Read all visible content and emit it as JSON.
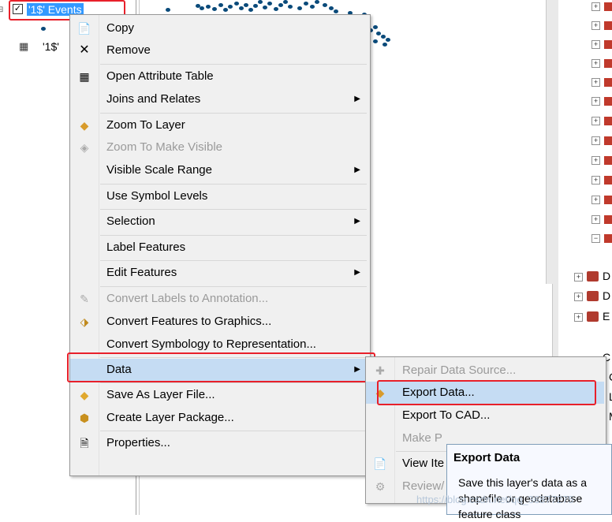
{
  "toc": {
    "layer_selected": "'1$' Events",
    "table_name": "'1$'"
  },
  "context_menu": {
    "items": [
      {
        "label": "Copy",
        "icon": "copy-icon"
      },
      {
        "label": "Remove",
        "icon": "remove-icon"
      },
      {
        "label": "Open Attribute Table",
        "icon": "table-icon"
      },
      {
        "label": "Joins and Relates",
        "submenu": true
      },
      {
        "label": "Zoom To Layer",
        "icon": "zoom-layer-icon"
      },
      {
        "label": "Zoom To Make Visible",
        "icon": "zoom-visible-icon",
        "disabled": true
      },
      {
        "label": "Visible Scale Range",
        "submenu": true
      },
      {
        "label": "Use Symbol Levels"
      },
      {
        "label": "Selection",
        "submenu": true
      },
      {
        "label": "Label Features"
      },
      {
        "label": "Edit Features",
        "submenu": true
      },
      {
        "label": "Convert Labels to Annotation...",
        "icon": "annotation-icon",
        "disabled": true
      },
      {
        "label": "Convert Features to Graphics...",
        "icon": "graphics-icon"
      },
      {
        "label": "Convert Symbology to Representation..."
      },
      {
        "label": "Data",
        "submenu": true,
        "highlighted": true
      },
      {
        "label": "Save As Layer File...",
        "icon": "layer-file-icon"
      },
      {
        "label": "Create Layer Package...",
        "icon": "layer-package-icon"
      },
      {
        "label": "Properties...",
        "icon": "properties-icon"
      }
    ]
  },
  "data_submenu": {
    "items": [
      {
        "label": "Repair Data Source...",
        "disabled": true
      },
      {
        "label": "Export Data...",
        "highlighted": true
      },
      {
        "label": "Export To CAD..."
      },
      {
        "label": "Make P"
      },
      {
        "label": "View Ite"
      },
      {
        "label": "Review/"
      }
    ]
  },
  "tooltip": {
    "title": "Export Data",
    "body": "Save this layer's data as a shapefile or geodatabase feature class"
  },
  "watermark": "https://blog.csdn.net/qq_36877275",
  "catalog": {
    "letters": [
      "D",
      "D",
      "E",
      "C",
      "C",
      "L",
      "M"
    ]
  },
  "colors": {
    "highlight": "#c5dcf3",
    "selection": "#3399ff",
    "annotation_red": "#e8202a",
    "points": "#0a4a7a"
  }
}
